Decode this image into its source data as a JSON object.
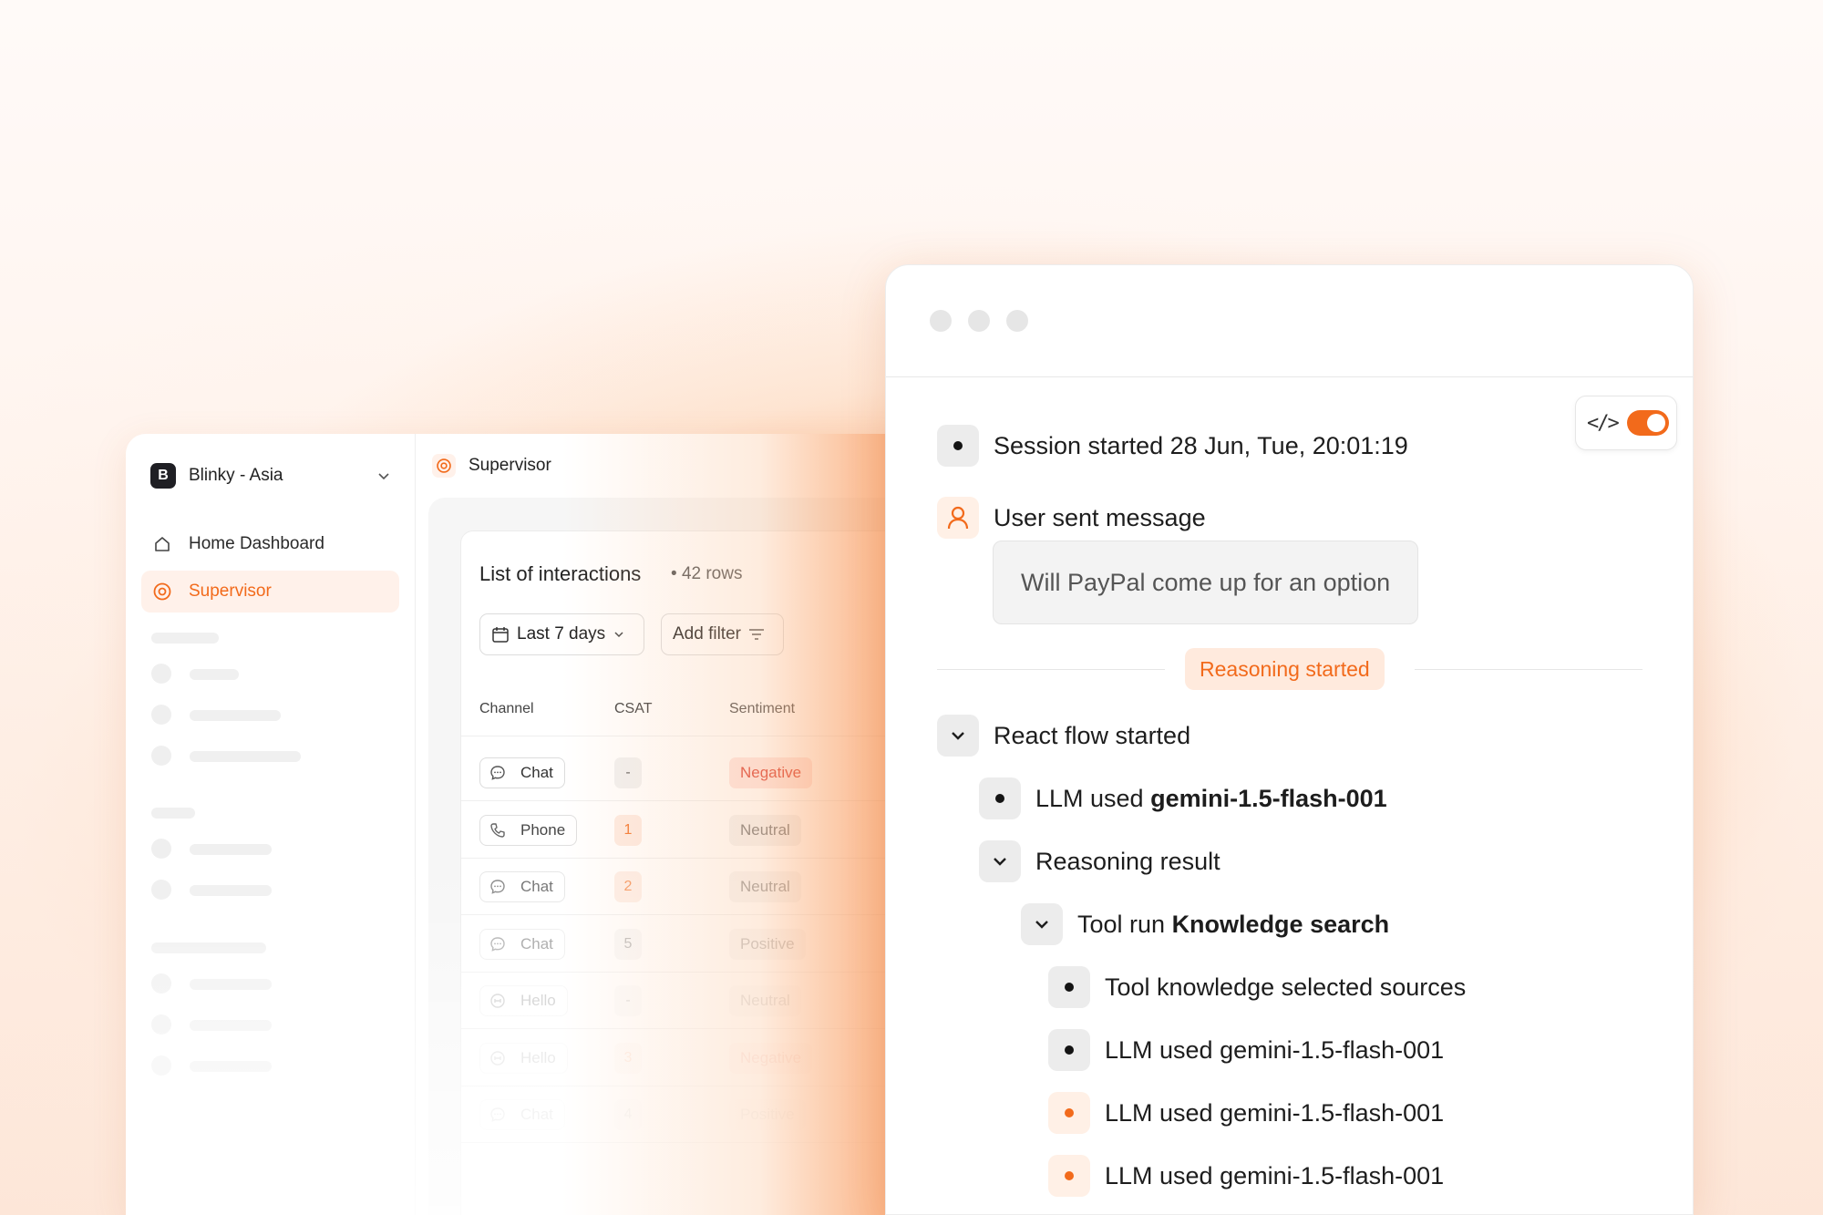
{
  "sidebar": {
    "workspace_initial": "B",
    "workspace_name": "Blinky - Asia",
    "items": [
      {
        "label": "Home Dashboard",
        "icon": "home-icon"
      },
      {
        "label": "Supervisor",
        "icon": "supervisor-icon",
        "active": true
      }
    ]
  },
  "header": {
    "title": "Supervisor"
  },
  "interactions": {
    "title": "List of interactions",
    "count": "42 rows",
    "date_filter": "Last 7 days",
    "add_filter": "Add filter",
    "columns": [
      "Channel",
      "CSAT",
      "Sentiment"
    ],
    "rows": [
      {
        "channel": "Chat",
        "csat": "-",
        "sentiment": "Negative"
      },
      {
        "channel": "Phone",
        "csat": "1",
        "sentiment": "Neutral"
      },
      {
        "channel": "Chat",
        "csat": "2",
        "sentiment": "Neutral"
      },
      {
        "channel": "Chat",
        "csat": "5",
        "sentiment": "Positive"
      },
      {
        "channel": "Hello",
        "csat": "-",
        "sentiment": "Neutral"
      },
      {
        "channel": "Hello",
        "csat": "3",
        "sentiment": "Negative"
      },
      {
        "channel": "Chat",
        "csat": "4",
        "sentiment": "Positive"
      }
    ]
  },
  "log": {
    "session_label": "Session started 28 Jun, Tue, 20:01:19",
    "user_sent": "User sent message",
    "user_message": "Will PayPal come up for an option",
    "reasoning_started": "Reasoning started",
    "react_flow": "React flow started",
    "llm_prefix": "LLM used ",
    "llm_model": "gemini-1.5-flash-001",
    "reasoning_result": "Reasoning result",
    "tool_run_prefix": "Tool run ",
    "tool_name": "Knowledge search",
    "tool_sources": "Tool knowledge selected sources",
    "llm_line": "LLM used gemini-1.5-flash-001"
  },
  "colors": {
    "accent": "#f26a1b",
    "accent_soft": "#fff0e6"
  }
}
